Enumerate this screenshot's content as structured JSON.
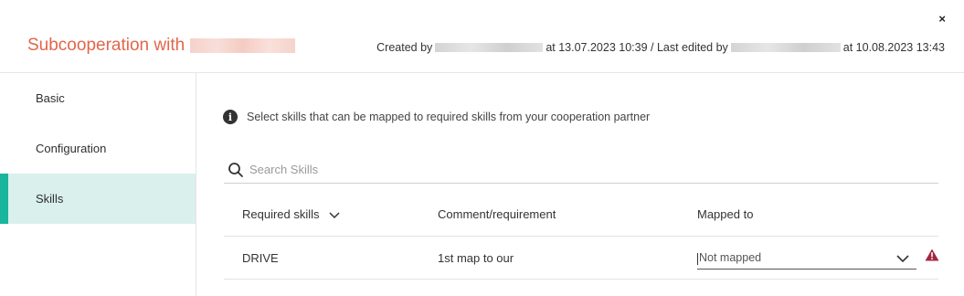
{
  "header": {
    "title": "Subcooperation with",
    "meta_created_prefix": "Created by",
    "meta_created_at": "at 13.07.2023 10:39 / Last edited by",
    "meta_edited_at": "at 10.08.2023 13:43",
    "close_label": "×"
  },
  "sidebar": {
    "items": [
      {
        "label": "Basic"
      },
      {
        "label": "Configuration"
      },
      {
        "label": "Skills"
      }
    ],
    "active_color": "#19b59d",
    "active_bg": "#d9f0ec"
  },
  "main": {
    "info_text": "Select skills that can be mapped to required skills from your cooperation partner",
    "search_placeholder": "Search Skills",
    "table": {
      "columns": [
        "Required skills",
        "Comment/requirement",
        "Mapped to"
      ],
      "rows": [
        {
          "skill": "DRIVE",
          "comment": "1st map to our",
          "mapped": "Not mapped"
        }
      ]
    }
  },
  "colors": {
    "title": "#e2664a",
    "warning": "#a3283f"
  }
}
